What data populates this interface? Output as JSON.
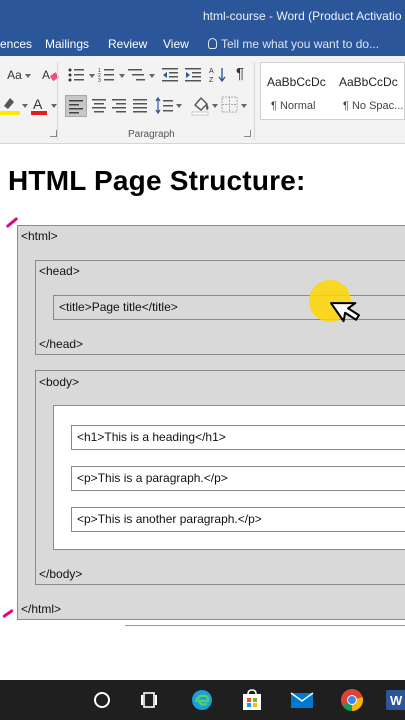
{
  "window": {
    "title": "html-course - Word (Product Activatio"
  },
  "ribbon_tabs": {
    "references": "ences",
    "mailings": "Mailings",
    "review": "Review",
    "view": "View",
    "tell_me": "Tell me what you want to do..."
  },
  "ribbon": {
    "font_size_label": "Aa",
    "group_paragraph": "Paragraph",
    "pilcrow": "¶",
    "styles": [
      {
        "sample": "AaBbCcDc",
        "name": "¶ Normal"
      },
      {
        "sample": "AaBbCcDc",
        "name": "¶ No Spac..."
      }
    ]
  },
  "document": {
    "heading": "HTML Page Structure:",
    "code": {
      "html_open": "<html>",
      "head_open": "<head>",
      "title": "<title>Page title</title>",
      "head_close": "</head>",
      "body_open": "<body>",
      "h1": "<h1>This is a heading</h1>",
      "p1": "<p>This is a paragraph.</p>",
      "p2": "<p>This is another paragraph.</p>",
      "body_close": "</body>",
      "html_close": "</html>"
    }
  },
  "colors": {
    "ribbon_blue": "#2b579a",
    "annotation_pink": "#e6007e",
    "cursor_highlight": "#ffd600",
    "box_gray": "#d9d9d9"
  },
  "taskbar": {
    "items": [
      "cortana-icon",
      "task-view-icon",
      "edge-icon",
      "store-icon",
      "mail-icon",
      "chrome-icon",
      "word-icon"
    ]
  }
}
